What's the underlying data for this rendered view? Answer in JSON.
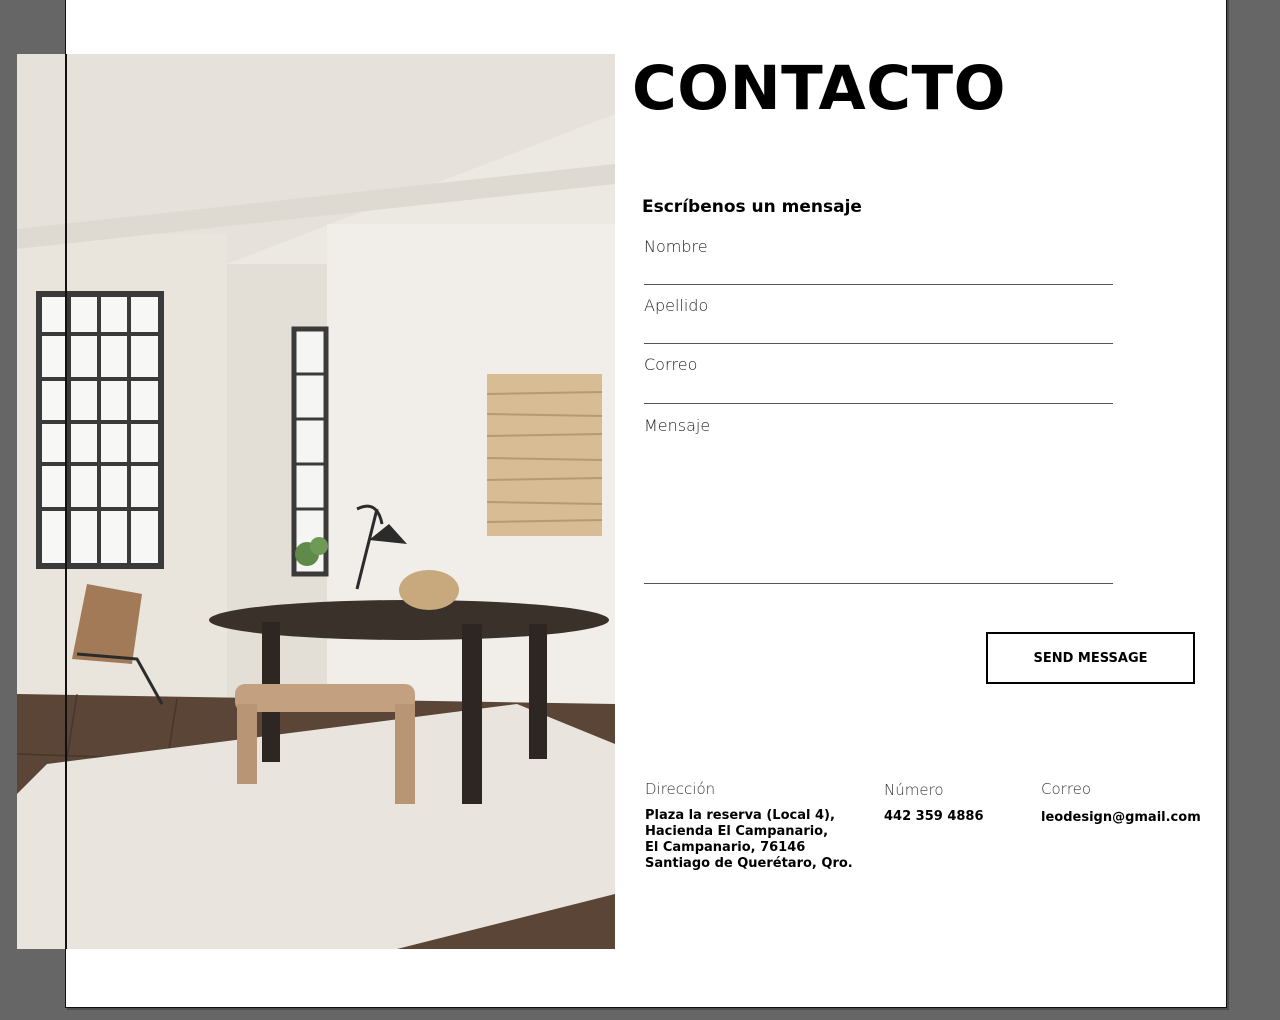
{
  "page": {
    "title": "CONTACTO",
    "photo_alt": "Dining room interior"
  },
  "form": {
    "heading": "Escríbenos un mensaje",
    "fields": [
      {
        "label": "Nombre",
        "value": ""
      },
      {
        "label": "Apellido",
        "value": ""
      },
      {
        "label": "Correo",
        "value": ""
      },
      {
        "label": "Mensaje",
        "value": ""
      }
    ],
    "submit_label": "SEND MESSAGE"
  },
  "info": {
    "address": {
      "label": "Dirección",
      "lines": [
        "Plaza la reserva (Local 4),",
        "Hacienda El Campanario,",
        "El Campanario, 76146",
        "Santiago de Querétaro, Qro."
      ]
    },
    "phone": {
      "label": "Número",
      "value": "442 359 4886"
    },
    "email": {
      "label": "Correo",
      "value": "leodesign@gmail.com"
    }
  },
  "colors": {
    "background": "#666666",
    "page": "#ffffff",
    "text": "#000000"
  }
}
